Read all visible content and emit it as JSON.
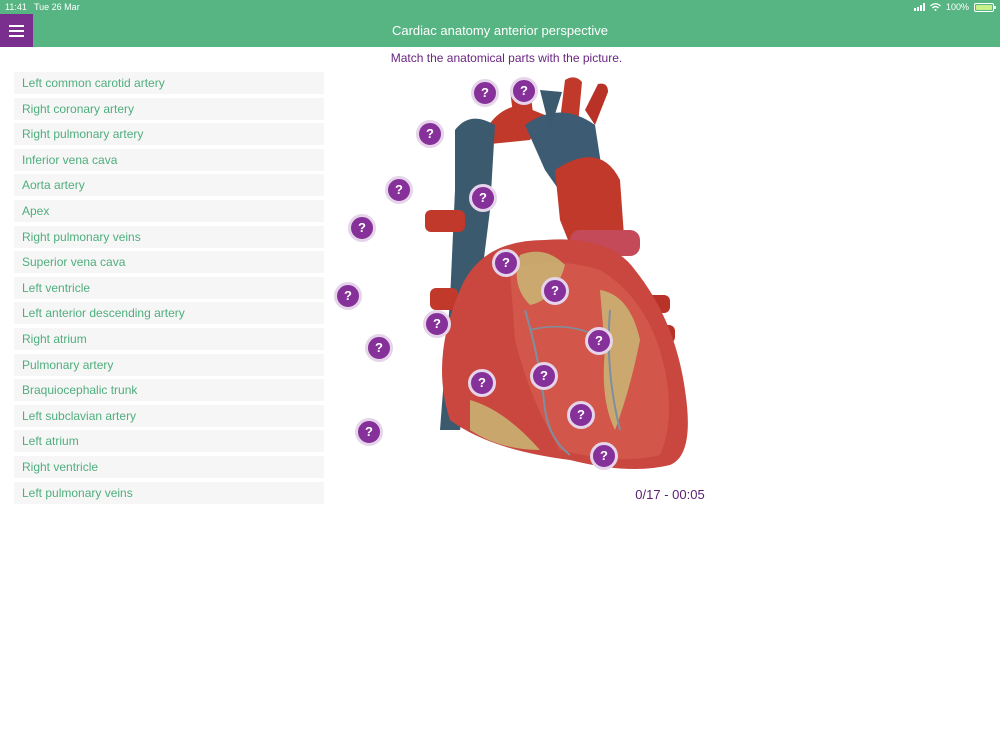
{
  "status": {
    "time": "11:41",
    "date": "Tue 26 Mar",
    "battery": "100%"
  },
  "header": {
    "title": "Cardiac anatomy anterior perspective"
  },
  "instruction": "Match the anatomical parts with the picture.",
  "parts": [
    "Left common carotid artery",
    "Right coronary artery",
    "Right pulmonary artery",
    "Inferior vena cava",
    "Aorta artery",
    "Apex",
    "Right pulmonary veins",
    "Superior vena cava",
    "Left ventricle",
    "Left anterior descending artery",
    "Right atrium",
    "Pulmonary artery",
    "Braquiocephalic trunk",
    "Left subclavian artery",
    "Left atrium",
    "Right ventricle",
    "Left pulmonary veins"
  ],
  "marker_symbol": "?",
  "score": "0/17 - 00:05",
  "colors": {
    "accent": "#57b583",
    "menu": "#7a2f8f",
    "marker": "#86319a",
    "instruction": "#6a2582"
  },
  "icons": {
    "menu": "hamburger-icon",
    "signal": "signal-icon",
    "wifi": "wifi-icon",
    "battery": "battery-icon",
    "marker": "question-mark-icon"
  }
}
